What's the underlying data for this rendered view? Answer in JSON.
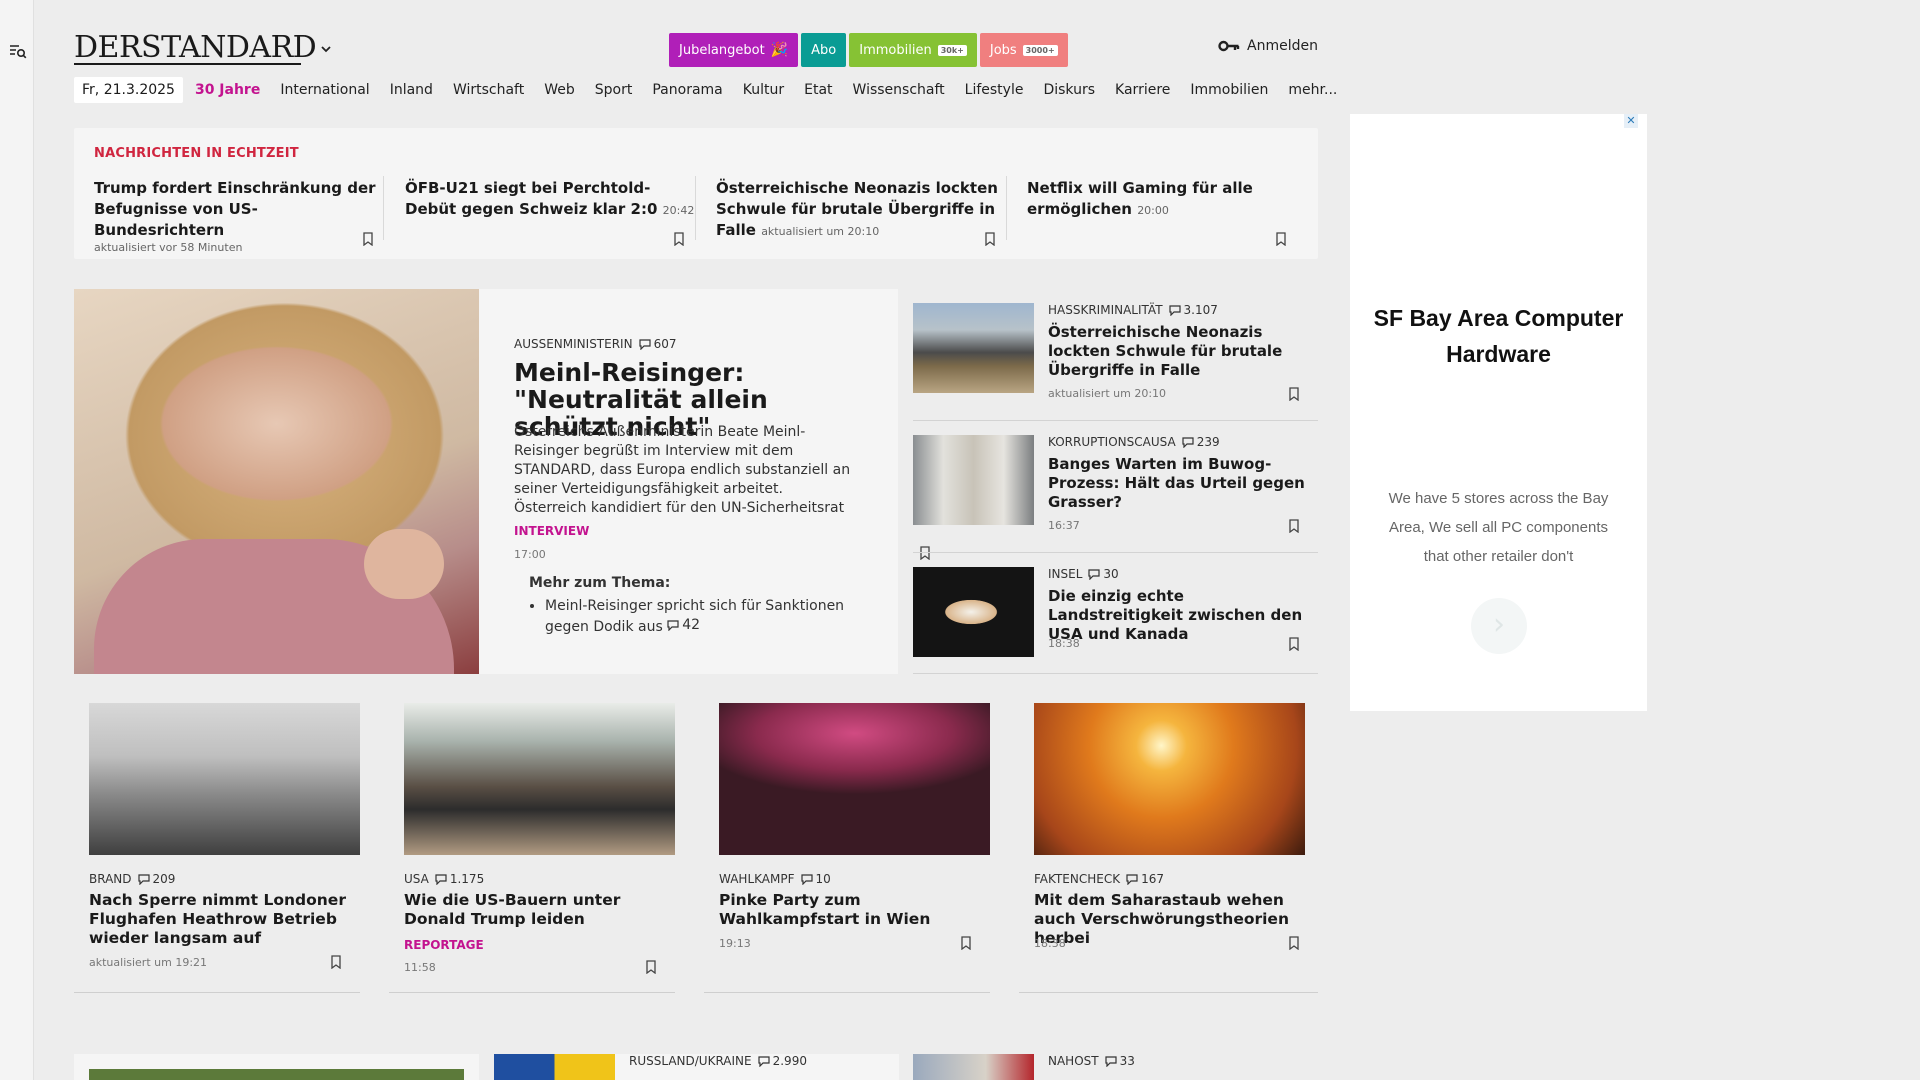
{
  "header": {
    "logo": "DERSTANDARD",
    "promos": [
      {
        "label": "Jubelangebot",
        "tag": "🎉"
      },
      {
        "label": "Abo",
        "tag": ""
      },
      {
        "label": "Immobilien",
        "tag": "30k+"
      },
      {
        "label": "Jobs",
        "tag": "3000+"
      }
    ],
    "login": "Anmelden"
  },
  "nav": {
    "date": "Fr, 21.3.2025",
    "items": [
      "30 Jahre",
      "International",
      "Inland",
      "Wirtschaft",
      "Web",
      "Sport",
      "Panorama",
      "Kultur",
      "Etat",
      "Wissenschaft",
      "Lifestyle",
      "Diskurs",
      "Karriere",
      "Immobilien",
      "mehr..."
    ]
  },
  "ticker": {
    "title": "NACHRICHTEN IN ECHTZEIT",
    "items": [
      {
        "headline": "Trump fordert Einschränkung der Befugnisse von US-Bundesrichtern",
        "time": "aktualisiert vor 58 Minuten"
      },
      {
        "headline": "ÖFB-U21 siegt bei Perchtold-Debüt gegen Schweiz klar 2:0",
        "time": "20:42"
      },
      {
        "headline": "Österreichische Neonazis lockten Schwule für brutale Übergriffe in Falle",
        "time": "aktualisiert um 20:10"
      },
      {
        "headline": "Netflix will Gaming für alle ermöglichen",
        "time": "20:00"
      }
    ]
  },
  "lead": {
    "kicker": "AUSSENMINISTERIN",
    "comments": "607",
    "title": "Meinl-Reisinger: \"Neutralität allein schützt nicht\"",
    "text": "Österreichs Außenministerin Beate Meinl-Reisinger begrüßt im Interview mit dem STANDARD, dass Europa endlich substanziell an seiner Verteidigungsfähigkeit arbeitet. Österreich kandidiert für den UN-Sicherheitsrat",
    "label": "INTERVIEW",
    "time": "17:00",
    "more_title": "Mehr zum Thema:",
    "more_item": "Meinl-Reisinger spricht sich für Sanktionen gegen Dodik aus",
    "more_comments": "42"
  },
  "side": [
    {
      "kicker": "HASSKRIMINALITÄT",
      "comments": "3.107",
      "headline": "Österreichische Neonazis lockten Schwule für brutale Übergriffe in Falle",
      "time": "aktualisiert um 20:10"
    },
    {
      "kicker": "KORRUPTIONSCAUSA",
      "comments": "239",
      "headline": "Banges Warten im Buwog-Prozess: Hält das Urteil gegen Grasser?",
      "time": "16:37"
    },
    {
      "kicker": "INSEL",
      "comments": "30",
      "headline": "Die einzig echte Landstreitigkeit zwischen den USA und Kanada",
      "time": "18:38"
    }
  ],
  "cards": [
    {
      "kicker": "BRAND",
      "comments": "209",
      "headline": "Nach Sperre nimmt Londoner Flughafen Heathrow Betrieb wieder langsam auf",
      "label": "",
      "time": "aktualisiert um 19:21"
    },
    {
      "kicker": "USA",
      "comments": "1.175",
      "headline": "Wie die US-Bauern unter Donald Trump leiden",
      "label": "REPORTAGE",
      "time": "11:58"
    },
    {
      "kicker": "WAHLKAMPF",
      "comments": "10",
      "headline": "Pinke Party zum Wahlkampfstart in Wien",
      "label": "",
      "time": "19:13"
    },
    {
      "kicker": "FAKTENCHECK",
      "comments": "167",
      "headline": "Mit dem Saharastaub wehen auch Verschwörungstheorien herbei",
      "label": "",
      "time": "18:38"
    }
  ],
  "bottom": [
    {
      "kicker": "RUSSLAND/UKRAINE",
      "comments": "2.990"
    },
    {
      "kicker": "NAHOST",
      "comments": "33"
    }
  ],
  "ad": {
    "title": "SF Bay Area Computer Hardware",
    "text": "We have 5 stores across the Bay Area, We sell all PC components that other retailer don't",
    "close": "✕",
    "arrow": "›"
  },
  "colors": {
    "accent": "#c3138f",
    "ticker_title": "#d0253f",
    "promo_jubel": "#b01fb8",
    "promo_abo": "#0a9c94",
    "promo_immo": "#86c234",
    "promo_jobs": "#f07f7f"
  }
}
